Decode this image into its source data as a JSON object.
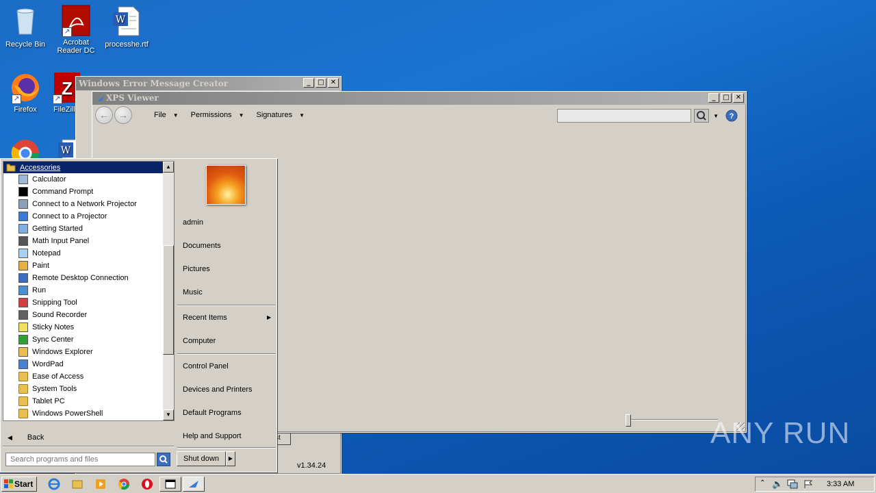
{
  "desktop": {
    "icons": [
      {
        "label": "Recycle Bin",
        "icon": "recycle-bin-icon"
      },
      {
        "label": "Acrobat Reader DC",
        "icon": "acrobat-icon"
      },
      {
        "label": "processhe.rtf",
        "icon": "word-document-icon"
      },
      {
        "label": "Firefox",
        "icon": "firefox-icon"
      },
      {
        "label": "FileZilla",
        "icon": "filezilla-icon"
      },
      {
        "label": "",
        "icon": "chrome-icon"
      },
      {
        "label": "",
        "icon": "word-document-icon"
      }
    ],
    "watermark": "ANY RUN"
  },
  "wemc_window": {
    "title": "Windows Error Message Creator",
    "version": "v1.34.24",
    "partial_button": "st"
  },
  "xps_window": {
    "title": "XPS Viewer",
    "menus": [
      "File",
      "Permissions",
      "Signatures"
    ]
  },
  "start_menu": {
    "folder_header": "Accessories",
    "programs": [
      {
        "label": "Calculator",
        "icon": "calculator-icon",
        "color": "#9fb8d8"
      },
      {
        "label": "Command Prompt",
        "icon": "command-prompt-icon",
        "color": "#000000"
      },
      {
        "label": "Connect to a Network Projector",
        "icon": "network-projector-icon",
        "color": "#8aa0b8"
      },
      {
        "label": "Connect to a Projector",
        "icon": "projector-icon",
        "color": "#3a7bd5"
      },
      {
        "label": "Getting Started",
        "icon": "getting-started-icon",
        "color": "#7fb0e0"
      },
      {
        "label": "Math Input Panel",
        "icon": "math-input-icon",
        "color": "#555555"
      },
      {
        "label": "Notepad",
        "icon": "notepad-icon",
        "color": "#a8d0f0"
      },
      {
        "label": "Paint",
        "icon": "paint-icon",
        "color": "#e8b040"
      },
      {
        "label": "Remote Desktop Connection",
        "icon": "remote-desktop-icon",
        "color": "#3a6fc0"
      },
      {
        "label": "Run",
        "icon": "run-icon",
        "color": "#4a90d0"
      },
      {
        "label": "Snipping Tool",
        "icon": "snipping-tool-icon",
        "color": "#d04040"
      },
      {
        "label": "Sound Recorder",
        "icon": "sound-recorder-icon",
        "color": "#606060"
      },
      {
        "label": "Sticky Notes",
        "icon": "sticky-notes-icon",
        "color": "#f0e060"
      },
      {
        "label": "Sync Center",
        "icon": "sync-center-icon",
        "color": "#30a030"
      },
      {
        "label": "Windows Explorer",
        "icon": "windows-explorer-icon",
        "color": "#e8c050"
      },
      {
        "label": "WordPad",
        "icon": "wordpad-icon",
        "color": "#4a80d0"
      },
      {
        "label": "Ease of Access",
        "icon": "folder-icon",
        "color": "#e8c050"
      },
      {
        "label": "System Tools",
        "icon": "folder-icon",
        "color": "#e8c050"
      },
      {
        "label": "Tablet PC",
        "icon": "folder-icon",
        "color": "#e8c050"
      },
      {
        "label": "Windows PowerShell",
        "icon": "folder-icon",
        "color": "#e8c050"
      }
    ],
    "back_label": "Back",
    "search_placeholder": "Search programs and files",
    "user": "admin",
    "right_items": {
      "documents": "Documents",
      "pictures": "Pictures",
      "music": "Music",
      "recent": "Recent Items",
      "computer": "Computer",
      "control_panel": "Control Panel",
      "devices": "Devices and Printers",
      "default_programs": "Default Programs",
      "help": "Help and Support"
    },
    "shutdown_label": "Shut down"
  },
  "taskbar": {
    "start_label": "Start",
    "clock": "3:33 AM"
  }
}
